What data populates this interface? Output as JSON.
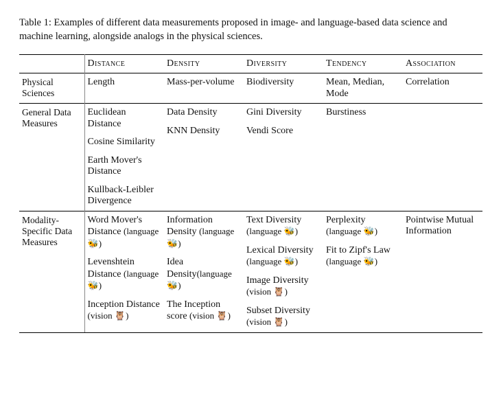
{
  "caption": "Table 1: Examples of different data measurements proposed in image- and language-based data science and machine learning, alongside analogs in the physical sciences.",
  "columns": [
    "Distance",
    "Density",
    "Diversity",
    "Tendency",
    "Association"
  ],
  "icons": {
    "language": "🐝",
    "vision": "🦉"
  },
  "tags": {
    "lang": "(language ",
    "vis": "(vision ",
    "close": ")"
  },
  "sections": [
    {
      "label": "Physical Sciences",
      "cells": {
        "distance": [
          {
            "text": "Length"
          }
        ],
        "density": [
          {
            "text": "Mass-per-volume"
          }
        ],
        "diversity": [
          {
            "text": "Biodiversity"
          }
        ],
        "tendency": [
          {
            "text": "Mean, Median, Mode"
          }
        ],
        "association": [
          {
            "text": "Correlation"
          }
        ]
      }
    },
    {
      "label": "General Data Measures",
      "cells": {
        "distance": [
          {
            "text": "Euclidean Distance"
          },
          {
            "text": "Cosine Similarity"
          },
          {
            "text": "Earth Mover's Distance"
          },
          {
            "text": "Kullback-Leibler Divergence"
          }
        ],
        "density": [
          {
            "text": "Data Density"
          },
          {
            "text": "KNN Density"
          }
        ],
        "diversity": [
          {
            "text": "Gini Diversity"
          },
          {
            "text": "Vendi Score"
          }
        ],
        "tendency": [
          {
            "text": "Burstiness"
          }
        ],
        "association": []
      }
    },
    {
      "label": "Modality-Specific Data Measures",
      "cells": {
        "distance": [
          {
            "text": "Word Mover's Distance",
            "tag": "lang"
          },
          {
            "text": "Levenshtein Distance",
            "tag": "lang"
          },
          {
            "text": "Inception Distance",
            "tag": "vis"
          }
        ],
        "density": [
          {
            "text": "Information Density",
            "tag": "lang"
          },
          {
            "text": "Idea Density",
            "tag": "lang",
            "nospace": true
          },
          {
            "text": "The Inception score",
            "tag": "vis"
          }
        ],
        "diversity": [
          {
            "text": "Text Diversity",
            "tag": "lang"
          },
          {
            "text": "Lexical Diversity",
            "tag": "lang"
          },
          {
            "text": "Image Diversity",
            "tag": "vis"
          },
          {
            "text": "Subset Diversity",
            "tag": "vis"
          }
        ],
        "tendency": [
          {
            "text": "Perplexity",
            "tag": "lang"
          },
          {
            "text": "Fit to Zipf's Law",
            "tag": "lang"
          }
        ],
        "association": [
          {
            "text": "Pointwise Mutual Information"
          }
        ]
      }
    }
  ]
}
